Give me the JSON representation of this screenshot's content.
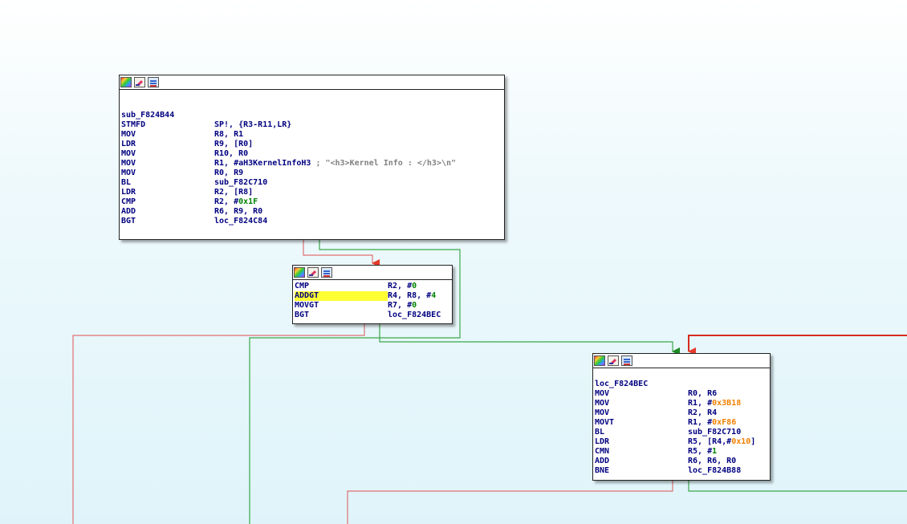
{
  "colors": {
    "false_edge": "#e74c3c",
    "true_edge": "#2e9c3a",
    "mnemonic": "#000080"
  },
  "icons": [
    "graph-icon",
    "edit-icon",
    "xref-icon"
  ],
  "blocks": {
    "b1": {
      "label": "sub_F824B44",
      "lines": [
        {
          "m": "STMFD",
          "ops": [
            {
              "t": "SP!, {R3-R11,LR}"
            }
          ]
        },
        {
          "m": "MOV",
          "ops": [
            {
              "t": "R8, R1"
            }
          ]
        },
        {
          "m": "LDR",
          "ops": [
            {
              "t": "R9, [R0]"
            }
          ]
        },
        {
          "m": "MOV",
          "ops": [
            {
              "t": "R10, R0"
            }
          ]
        },
        {
          "m": "MOV",
          "ops": [
            {
              "t": "R1, #aH3KernelInfoH3 "
            },
            {
              "t": "; \"<h3>Kernel Info : </h3>\\n\"",
              "c": "cmt"
            }
          ]
        },
        {
          "m": "MOV",
          "ops": [
            {
              "t": "R0, R9"
            }
          ]
        },
        {
          "m": "BL",
          "ops": [
            {
              "t": "sub_F82C710"
            }
          ]
        },
        {
          "m": "LDR",
          "ops": [
            {
              "t": "R2, [R8]"
            }
          ]
        },
        {
          "m": "CMP",
          "ops": [
            {
              "t": "R2, #"
            },
            {
              "t": "0x1F",
              "c": "hexg"
            }
          ]
        },
        {
          "m": "ADD",
          "ops": [
            {
              "t": "R6, R9, R0"
            }
          ]
        },
        {
          "m": "BGT",
          "ops": [
            {
              "t": "loc_F824C84"
            }
          ]
        }
      ]
    },
    "b2": {
      "lines": [
        {
          "m": "CMP",
          "ops": [
            {
              "t": "R2, #"
            },
            {
              "t": "0",
              "c": "hexg"
            }
          ]
        },
        {
          "m": "ADDGT",
          "hl": true,
          "ops": [
            {
              "t": "R4, R8, #"
            },
            {
              "t": "4",
              "c": "hexg"
            }
          ]
        },
        {
          "m": "MOVGT",
          "ops": [
            {
              "t": "R7, #"
            },
            {
              "t": "0",
              "c": "hexg"
            }
          ]
        },
        {
          "m": "BGT",
          "ops": [
            {
              "t": "loc_F824BEC"
            }
          ]
        }
      ]
    },
    "b3": {
      "label": "loc_F824BEC",
      "lines": [
        {
          "m": "MOV",
          "ops": [
            {
              "t": "R0, R6"
            }
          ]
        },
        {
          "m": "MOV",
          "ops": [
            {
              "t": "R1, #"
            },
            {
              "t": "0x3B18",
              "c": "num"
            }
          ]
        },
        {
          "m": "MOV",
          "ops": [
            {
              "t": "R2, R4"
            }
          ]
        },
        {
          "m": "MOVT",
          "ops": [
            {
              "t": "R1, #"
            },
            {
              "t": "0xF86",
              "c": "num"
            }
          ]
        },
        {
          "m": "BL",
          "ops": [
            {
              "t": "sub_F82C710"
            }
          ]
        },
        {
          "m": "LDR",
          "ops": [
            {
              "t": "R5, [R4,#"
            },
            {
              "t": "0x10",
              "c": "num"
            },
            {
              "t": "]"
            }
          ]
        },
        {
          "m": "CMN",
          "ops": [
            {
              "t": "R5, #"
            },
            {
              "t": "1",
              "c": "hexg"
            }
          ]
        },
        {
          "m": "ADD",
          "ops": [
            {
              "t": "R6, R6, R0"
            }
          ]
        },
        {
          "m": "BNE",
          "ops": [
            {
              "t": "loc_F824B88"
            }
          ]
        }
      ]
    }
  }
}
